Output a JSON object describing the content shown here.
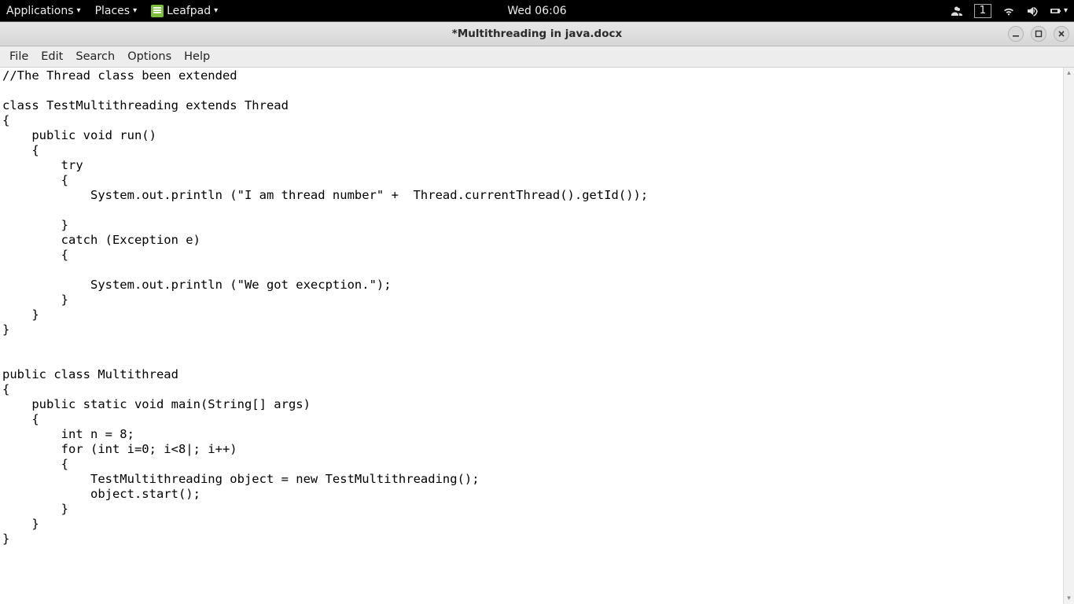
{
  "panel": {
    "applications": "Applications",
    "places": "Places",
    "app_name": "Leafpad",
    "clock": "Wed 06:06",
    "workspace": "1"
  },
  "window": {
    "title": "*Multithreading in java.docx"
  },
  "menubar": {
    "file": "File",
    "edit": "Edit",
    "search": "Search",
    "options": "Options",
    "help": "Help"
  },
  "editor": {
    "content": "//The Thread class been extended\n\nclass TestMultithreading extends Thread\n{\n    public void run()\n    {\n        try\n        {\n            System.out.println (\"I am thread number\" +  Thread.currentThread().getId());\n\n        }\n        catch (Exception e)\n        {\n\n            System.out.println (\"We got execption.\");\n        }\n    }\n}\n\n\npublic class Multithread\n{\n    public static void main(String[] args)\n    {\n        int n = 8;\n        for (int i=0; i<8|; i++)\n        {\n            TestMultithreading object = new TestMultithreading();\n            object.start();\n        }\n    }\n}"
  }
}
